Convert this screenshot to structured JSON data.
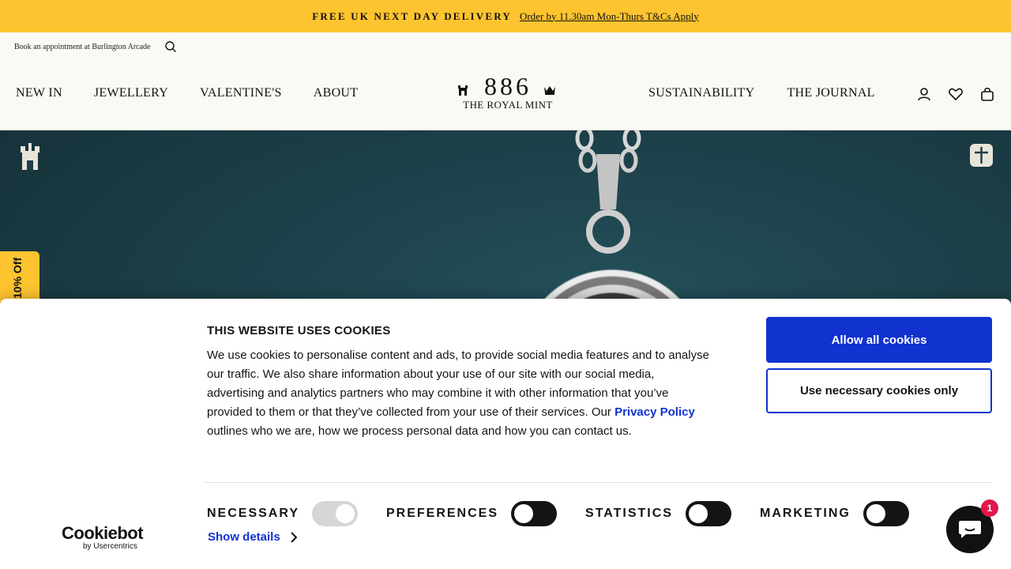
{
  "announcement": {
    "main": "FREE UK NEXT DAY DELIVERY",
    "link": "Order by 11.30am Mon-Thurs T&Cs Apply"
  },
  "header": {
    "appointment": "Book an appointment at Burlington Arcade",
    "nav_left": [
      "NEW IN",
      "JEWELLERY",
      "VALENTINE'S",
      "ABOUT"
    ],
    "nav_right": [
      "SUSTAINABILITY",
      "THE JOURNAL"
    ],
    "logo": {
      "number": "886",
      "subtitle": "THE ROYAL MINT"
    },
    "icons": [
      "account-icon",
      "wishlist-heart-icon",
      "bag-icon"
    ]
  },
  "promo_tab": {
    "label": "10% Off"
  },
  "cookie_banner": {
    "title": "THIS WEBSITE USES COOKIES",
    "body_before": "We use cookies to personalise content and ads, to provide social media features and to analyse our traffic. We also share information about your use of our site with our social media, advertising and analytics partners who may combine it with other information that you’ve provided to them or that they’ve collected from your use of their services. Our ",
    "privacy_link": "Privacy Policy",
    "body_after": " outlines who we are, how we process personal data and how you can contact us.",
    "allow_all": "Allow all cookies",
    "necessary_only": "Use necessary cookies only",
    "toggles": [
      {
        "label": "NECESSARY",
        "on": true
      },
      {
        "label": "PREFERENCES",
        "on": false
      },
      {
        "label": "STATISTICS",
        "on": false
      },
      {
        "label": "MARKETING",
        "on": false
      }
    ],
    "show_details": "Show details",
    "brand": {
      "name": "Cookiebot",
      "by": "by Usercentrics"
    }
  },
  "chat": {
    "badge_count": "1"
  },
  "colors": {
    "accent_yellow": "#fec42f",
    "cookie_blue": "#1032cf",
    "hero_teal": "#1f3f48"
  }
}
